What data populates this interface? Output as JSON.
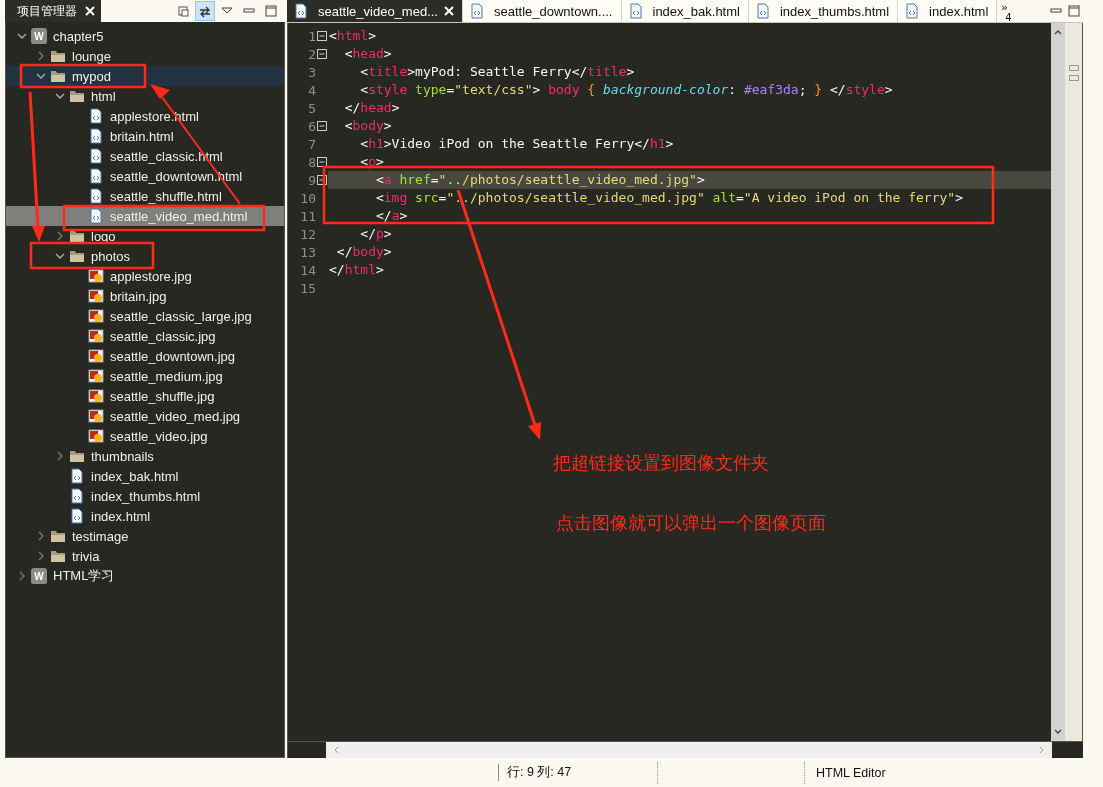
{
  "explorer": {
    "title": "项目管理器",
    "toolbar": [
      {
        "kind": "collapse",
        "pressed": false
      },
      {
        "kind": "link",
        "pressed": true
      },
      {
        "kind": "menu",
        "pressed": false
      },
      {
        "kind": "minimize",
        "pressed": false
      },
      {
        "kind": "maximize",
        "pressed": false
      }
    ],
    "tree": [
      {
        "label": "chapter5",
        "kind": "project",
        "badge": "W",
        "expanded": true,
        "selected": false,
        "hovered": false,
        "children": [
          {
            "label": "lounge",
            "kind": "folder",
            "expanded": false,
            "selected": false,
            "hovered": false
          },
          {
            "label": "mypod",
            "kind": "folder",
            "expanded": true,
            "selected": false,
            "hovered": true,
            "children": [
              {
                "label": "html",
                "kind": "folder",
                "expanded": true,
                "selected": false,
                "hovered": false,
                "children": [
                  {
                    "label": "applestore.html",
                    "kind": "html",
                    "selected": false,
                    "hovered": false
                  },
                  {
                    "label": "britain.html",
                    "kind": "html",
                    "selected": false,
                    "hovered": false
                  },
                  {
                    "label": "seattle_classic.html",
                    "kind": "html",
                    "selected": false,
                    "hovered": false
                  },
                  {
                    "label": "seattle_downtown.html",
                    "kind": "html",
                    "selected": false,
                    "hovered": false
                  },
                  {
                    "label": "seattle_shuffle.html",
                    "kind": "html",
                    "selected": false,
                    "hovered": false
                  },
                  {
                    "label": "seattle_video_med.html",
                    "kind": "html",
                    "selected": true,
                    "hovered": false
                  }
                ]
              },
              {
                "label": "logo",
                "kind": "folder",
                "expanded": false,
                "selected": false,
                "hovered": false
              },
              {
                "label": "photos",
                "kind": "folder",
                "expanded": true,
                "selected": false,
                "hovered": false,
                "children": [
                  {
                    "label": "applestore.jpg",
                    "kind": "image",
                    "selected": false,
                    "hovered": false
                  },
                  {
                    "label": "britain.jpg",
                    "kind": "image",
                    "selected": false,
                    "hovered": false
                  },
                  {
                    "label": "seattle_classic_large.jpg",
                    "kind": "image",
                    "selected": false,
                    "hovered": false
                  },
                  {
                    "label": "seattle_classic.jpg",
                    "kind": "image",
                    "selected": false,
                    "hovered": false
                  },
                  {
                    "label": "seattle_downtown.jpg",
                    "kind": "image",
                    "selected": false,
                    "hovered": false
                  },
                  {
                    "label": "seattle_medium.jpg",
                    "kind": "image",
                    "selected": false,
                    "hovered": false
                  },
                  {
                    "label": "seattle_shuffle.jpg",
                    "kind": "image",
                    "selected": false,
                    "hovered": false
                  },
                  {
                    "label": "seattle_video_med.jpg",
                    "kind": "image",
                    "selected": false,
                    "hovered": false
                  },
                  {
                    "label": "seattle_video.jpg",
                    "kind": "image",
                    "selected": false,
                    "hovered": false
                  }
                ]
              },
              {
                "label": "thumbnails",
                "kind": "folder",
                "expanded": false,
                "selected": false,
                "hovered": false
              },
              {
                "label": "index_bak.html",
                "kind": "html",
                "selected": false,
                "hovered": false
              },
              {
                "label": "index_thumbs.html",
                "kind": "html",
                "selected": false,
                "hovered": false
              },
              {
                "label": "index.html",
                "kind": "html",
                "selected": false,
                "hovered": false
              }
            ]
          },
          {
            "label": "testimage",
            "kind": "folder",
            "expanded": false,
            "selected": false,
            "hovered": false
          },
          {
            "label": "trivia",
            "kind": "folder",
            "expanded": false,
            "selected": false,
            "hovered": false
          }
        ]
      },
      {
        "label": "HTML学习",
        "kind": "project",
        "badge": "W",
        "expanded": false,
        "selected": false,
        "hovered": false
      }
    ]
  },
  "editor": {
    "tabs": [
      {
        "label": "seattle_video_med...",
        "selected": true,
        "closable": true
      },
      {
        "label": "seattle_downtown....",
        "selected": false,
        "closable": false
      },
      {
        "label": "index_bak.html",
        "selected": false,
        "closable": false
      },
      {
        "label": "index_thumbs.html",
        "selected": false,
        "closable": false
      },
      {
        "label": "index.html",
        "selected": false,
        "closable": false
      }
    ],
    "overflow": {
      "arrows": "»",
      "count": "4"
    },
    "lines": [
      {
        "number": "1",
        "fold": true,
        "current": false,
        "tokens": [
          {
            "kind": "punct",
            "text": "<"
          },
          {
            "kind": "tag",
            "text": "html"
          },
          {
            "kind": "punct",
            "text": ">"
          }
        ]
      },
      {
        "number": "2",
        "fold": true,
        "current": false,
        "tokens": [
          {
            "kind": "punct",
            "text": "  <"
          },
          {
            "kind": "tag",
            "text": "head"
          },
          {
            "kind": "punct",
            "text": ">"
          }
        ]
      },
      {
        "number": "3",
        "fold": false,
        "current": false,
        "tokens": [
          {
            "kind": "punct",
            "text": "    <"
          },
          {
            "kind": "tag",
            "text": "title"
          },
          {
            "kind": "punct",
            "text": ">myPod: Seattle Ferry</"
          },
          {
            "kind": "tag",
            "text": "title"
          },
          {
            "kind": "punct",
            "text": ">"
          }
        ]
      },
      {
        "number": "4",
        "fold": false,
        "current": false,
        "tokens": [
          {
            "kind": "punct",
            "text": "    <"
          },
          {
            "kind": "tag",
            "text": "style"
          },
          {
            "kind": "attr",
            "text": " type"
          },
          {
            "kind": "punct",
            "text": "="
          },
          {
            "kind": "string",
            "text": "\"text/css\""
          },
          {
            "kind": "punct",
            "text": "> "
          },
          {
            "kind": "tag",
            "text": "body"
          },
          {
            "kind": "brace",
            "text": " {"
          },
          {
            "kind": "prop",
            "text": " background-color"
          },
          {
            "kind": "punct",
            "text": ": "
          },
          {
            "kind": "value",
            "text": "#eaf3da"
          },
          {
            "kind": "punct",
            "text": "; "
          },
          {
            "kind": "brace",
            "text": "}"
          },
          {
            "kind": "punct",
            "text": " </"
          },
          {
            "kind": "tag",
            "text": "style"
          },
          {
            "kind": "punct",
            "text": ">"
          }
        ]
      },
      {
        "number": "5",
        "fold": false,
        "current": false,
        "tokens": [
          {
            "kind": "punct",
            "text": "  </"
          },
          {
            "kind": "tag",
            "text": "head"
          },
          {
            "kind": "punct",
            "text": ">"
          }
        ]
      },
      {
        "number": "6",
        "fold": true,
        "current": false,
        "tokens": [
          {
            "kind": "punct",
            "text": "  <"
          },
          {
            "kind": "tag",
            "text": "body"
          },
          {
            "kind": "punct",
            "text": ">"
          }
        ]
      },
      {
        "number": "7",
        "fold": false,
        "current": false,
        "tokens": [
          {
            "kind": "punct",
            "text": "    <"
          },
          {
            "kind": "tag",
            "text": "h1"
          },
          {
            "kind": "punct",
            "text": ">Video iPod on the Seattle Ferry</"
          },
          {
            "kind": "tag",
            "text": "h1"
          },
          {
            "kind": "punct",
            "text": ">"
          }
        ]
      },
      {
        "number": "8",
        "fold": true,
        "current": false,
        "tokens": [
          {
            "kind": "punct",
            "text": "    <"
          },
          {
            "kind": "tag",
            "text": "p"
          },
          {
            "kind": "punct",
            "text": ">"
          }
        ]
      },
      {
        "number": "9",
        "fold": true,
        "current": true,
        "tokens": [
          {
            "kind": "punct",
            "text": "      <"
          },
          {
            "kind": "tag",
            "text": "a"
          },
          {
            "kind": "attr",
            "text": " href"
          },
          {
            "kind": "punct",
            "text": "="
          },
          {
            "kind": "string",
            "text": "\"../photos/seattle_video_med.jpg\""
          },
          {
            "kind": "punct",
            "text": ">"
          }
        ]
      },
      {
        "number": "10",
        "fold": false,
        "current": false,
        "tokens": [
          {
            "kind": "punct",
            "text": "      <"
          },
          {
            "kind": "tag",
            "text": "img"
          },
          {
            "kind": "attr",
            "text": " src"
          },
          {
            "kind": "punct",
            "text": "="
          },
          {
            "kind": "string",
            "text": "\"../photos/seattle_video_med.jpg\""
          },
          {
            "kind": "attr",
            "text": " alt"
          },
          {
            "kind": "punct",
            "text": "="
          },
          {
            "kind": "string",
            "text": "\"A video iPod on the ferry\""
          },
          {
            "kind": "punct",
            "text": ">"
          }
        ]
      },
      {
        "number": "11",
        "fold": false,
        "current": false,
        "tokens": [
          {
            "kind": "punct",
            "text": "      </"
          },
          {
            "kind": "tag",
            "text": "a"
          },
          {
            "kind": "punct",
            "text": ">"
          }
        ]
      },
      {
        "number": "12",
        "fold": false,
        "current": false,
        "tokens": [
          {
            "kind": "punct",
            "text": "    </"
          },
          {
            "kind": "tag",
            "text": "p"
          },
          {
            "kind": "punct",
            "text": ">"
          }
        ]
      },
      {
        "number": "13",
        "fold": false,
        "current": false,
        "tokens": [
          {
            "kind": "punct",
            "text": " </"
          },
          {
            "kind": "tag",
            "text": "body"
          },
          {
            "kind": "punct",
            "text": ">"
          }
        ]
      },
      {
        "number": "14",
        "fold": false,
        "current": false,
        "tokens": [
          {
            "kind": "punct",
            "text": "</"
          },
          {
            "kind": "tag",
            "text": "html"
          },
          {
            "kind": "punct",
            "text": ">"
          }
        ]
      },
      {
        "number": "15",
        "fold": false,
        "current": false
      }
    ]
  },
  "annotations": [
    "把超链接设置到图像文件夹",
    "点击图像就可以弹出一个图像页面"
  ],
  "status_bar": {
    "position": "行: 9 列: 47",
    "editor_type": "HTML Editor"
  }
}
